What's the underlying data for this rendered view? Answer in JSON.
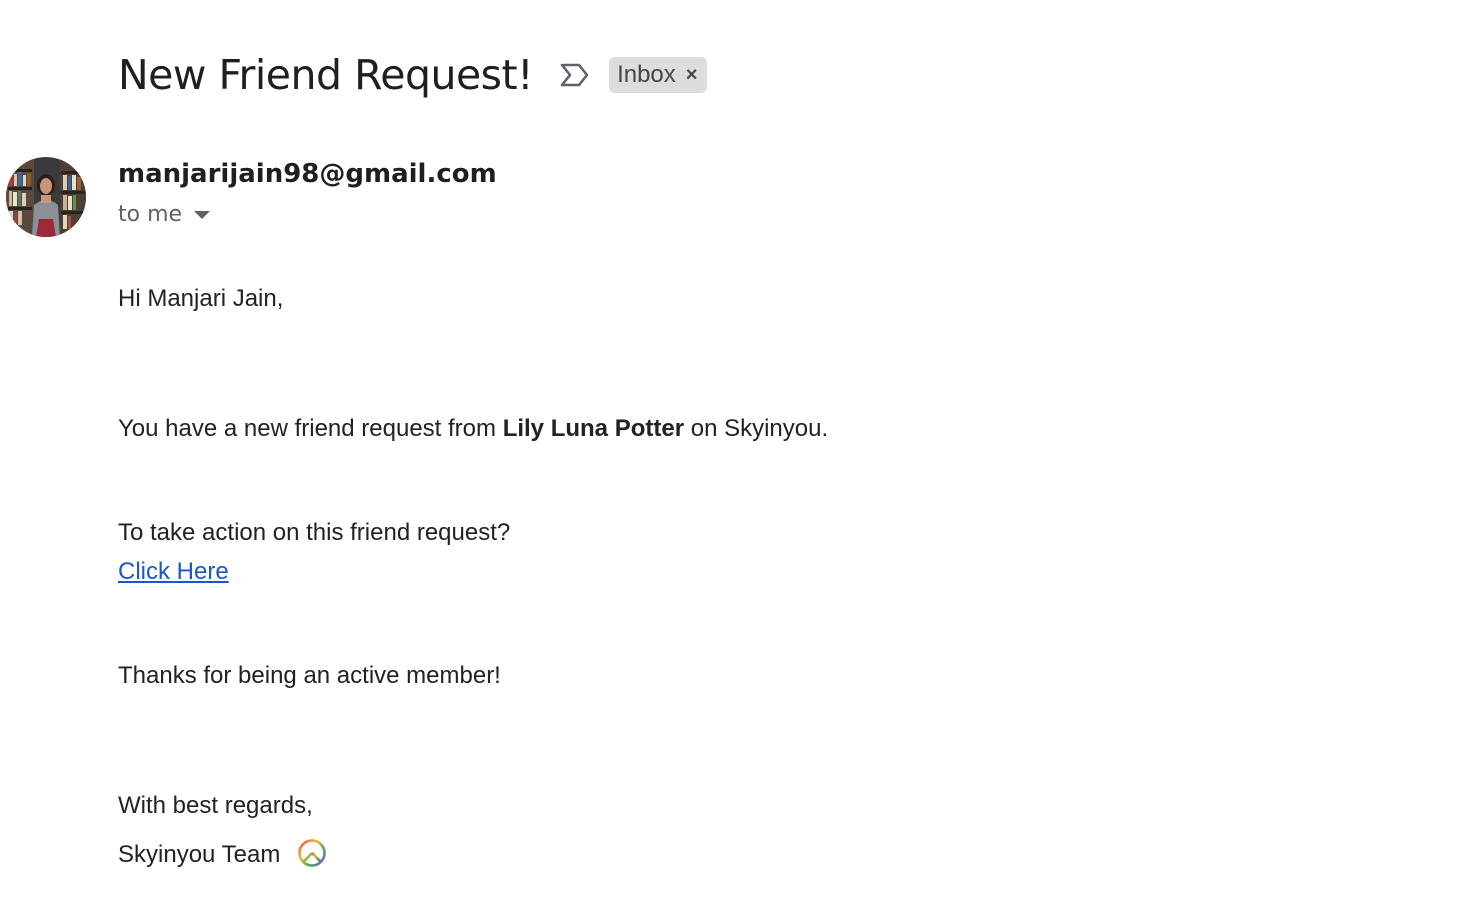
{
  "email": {
    "subject": "New Friend Request!",
    "label": "Inbox",
    "sender": "manjarijain98@gmail.com",
    "recipient": "to me"
  },
  "body": {
    "greeting": "Hi Manjari Jain,",
    "request_prefix": "You have a new friend request from ",
    "request_name": "Lily Luna Potter",
    "request_suffix": " on Skyinyou.",
    "action_prompt": "To take action on this friend request?",
    "action_link": "Click Here",
    "thanks": "Thanks for being an active member!",
    "closing": "With best regards,",
    "signature": "Skyinyou Team"
  },
  "icons": {
    "importance": "importance-marker-icon",
    "label_remove": "close-icon",
    "recipient_details": "chevron-down-icon",
    "signature_emoji": "peace-symbol-icon"
  },
  "colors": {
    "link": "#1a57c9",
    "chip_background": "#dddddd"
  }
}
